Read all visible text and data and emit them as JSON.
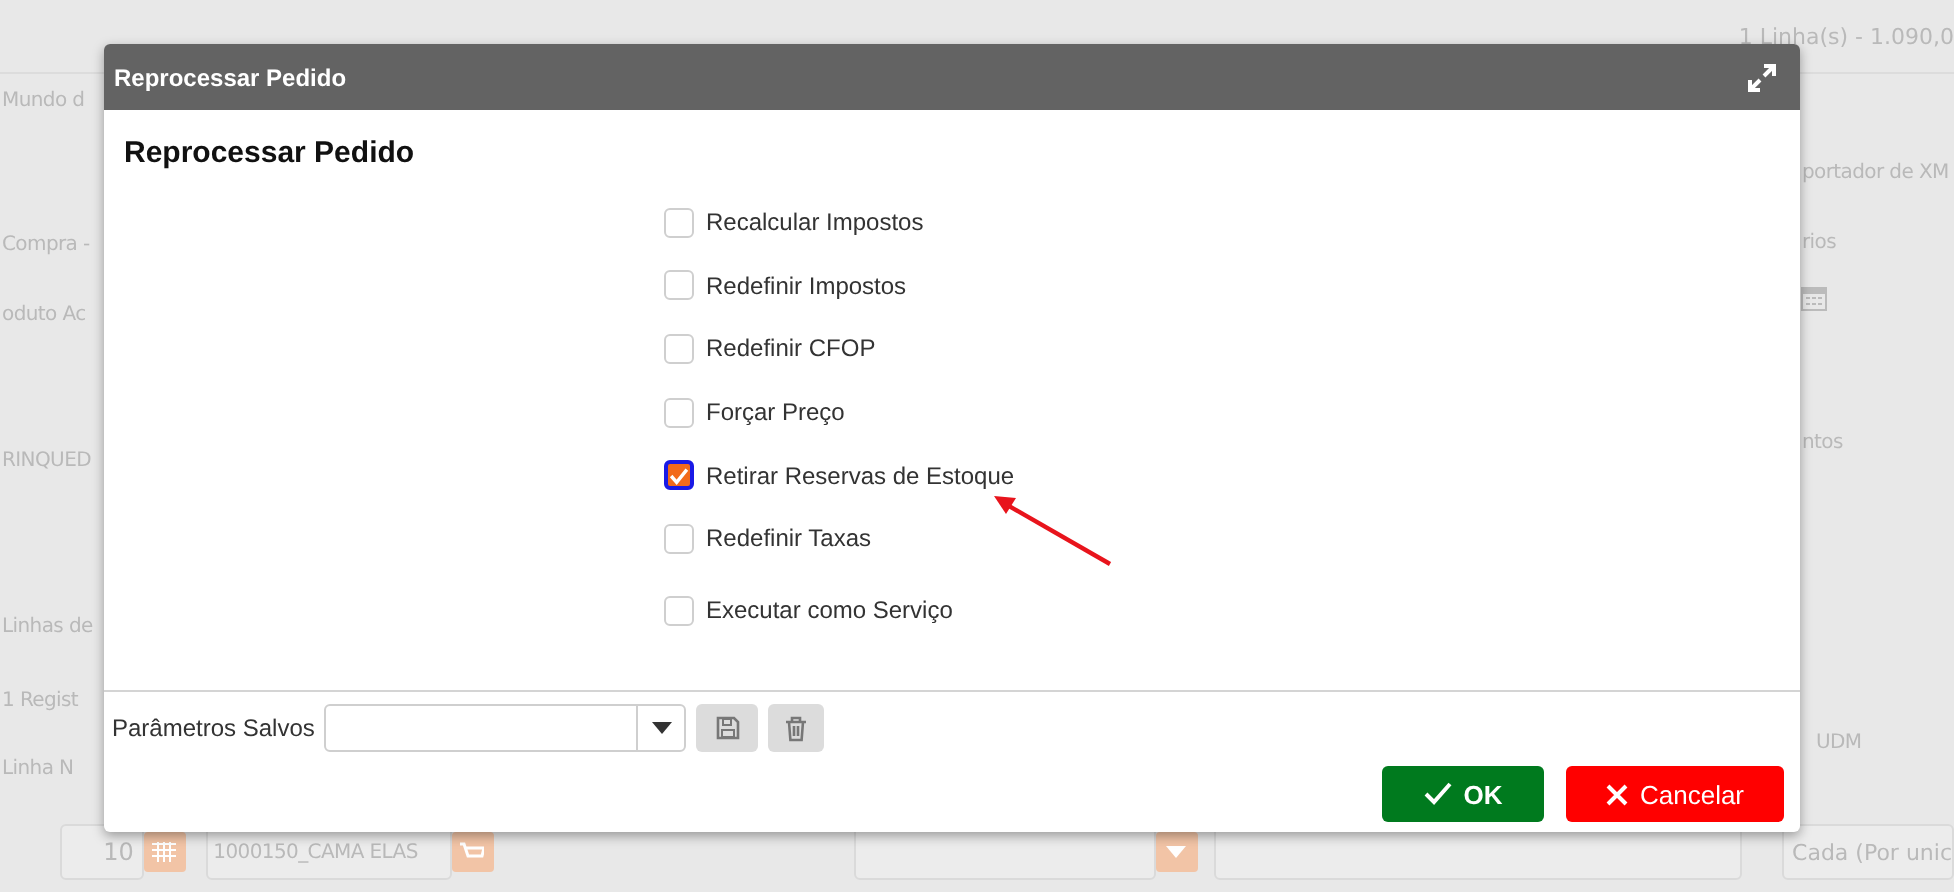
{
  "background": {
    "summary": "1 Linha(s) - 1.090,0",
    "left_fragments": [
      "Mundo d",
      "Compra -",
      "oduto Ac",
      "RINQUED",
      "Linhas de",
      "1 Regist",
      "Linha N"
    ],
    "right_fragments": [
      "portador de XM",
      "rios",
      "ntos",
      "UDM"
    ],
    "bottom_row": {
      "line_number": "10",
      "product": "1000150_CAMA ELAS",
      "unit": "Cada (Por unic"
    }
  },
  "dialog": {
    "title": "Reprocessar Pedido",
    "heading": "Reprocessar Pedido",
    "options": [
      {
        "label": "Recalcular Impostos",
        "checked": false
      },
      {
        "label": "Redefinir Impostos",
        "checked": false
      },
      {
        "label": "Redefinir CFOP",
        "checked": false
      },
      {
        "label": "Forçar Preço",
        "checked": false
      },
      {
        "label": "Retirar Reservas de Estoque",
        "checked": true
      },
      {
        "label": "Redefinir Taxas",
        "checked": false
      },
      {
        "label": "Executar como Serviço",
        "checked": false
      }
    ],
    "saved_parameters": {
      "label": "Parâmetros Salvos"
    },
    "buttons": [
      {
        "label": "OK",
        "kind": "ok"
      },
      {
        "label": "Cancelar",
        "kind": "cancel"
      }
    ]
  }
}
